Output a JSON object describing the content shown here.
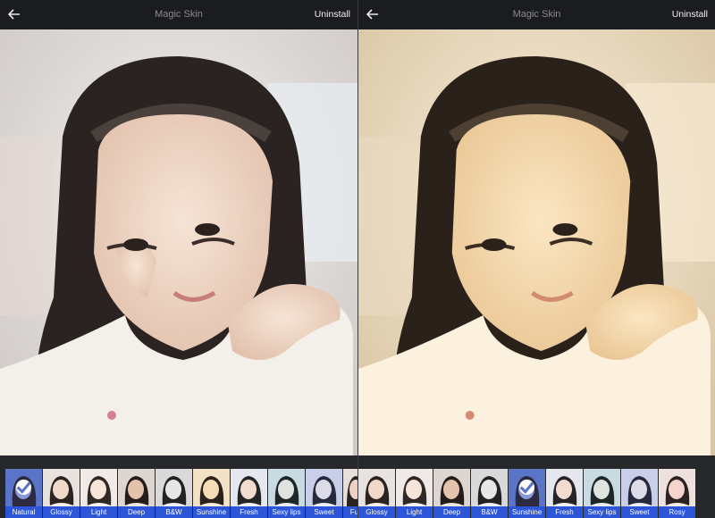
{
  "header": {
    "title": "Magic Skin",
    "uninstall_label": "Uninstall"
  },
  "colors": {
    "bar_background": "#1b1c1f",
    "strip_background": "#27282c",
    "label_background": "#2c55d8",
    "selected_overlay": "#4d6fd2"
  },
  "icons": {
    "back": "back-arrow-icon",
    "selected": "checkmark-icon"
  },
  "left_panel": {
    "filters": [
      {
        "label": "Natural",
        "selected": true
      },
      {
        "label": "Glossy"
      },
      {
        "label": "Light"
      },
      {
        "label": "Deep"
      },
      {
        "label": "B&W"
      },
      {
        "label": "Sunshine"
      },
      {
        "label": "Fresh"
      },
      {
        "label": "Sexy lips"
      },
      {
        "label": "Sweet"
      },
      {
        "label": "Fural"
      }
    ]
  },
  "right_panel": {
    "filters": [
      {
        "label": "Glossy"
      },
      {
        "label": "Light"
      },
      {
        "label": "Deep"
      },
      {
        "label": "B&W"
      },
      {
        "label": "Sunshine",
        "selected": true
      },
      {
        "label": "Fresh"
      },
      {
        "label": "Sexy lips"
      },
      {
        "label": "Sweet"
      },
      {
        "label": "Rosy"
      }
    ]
  }
}
